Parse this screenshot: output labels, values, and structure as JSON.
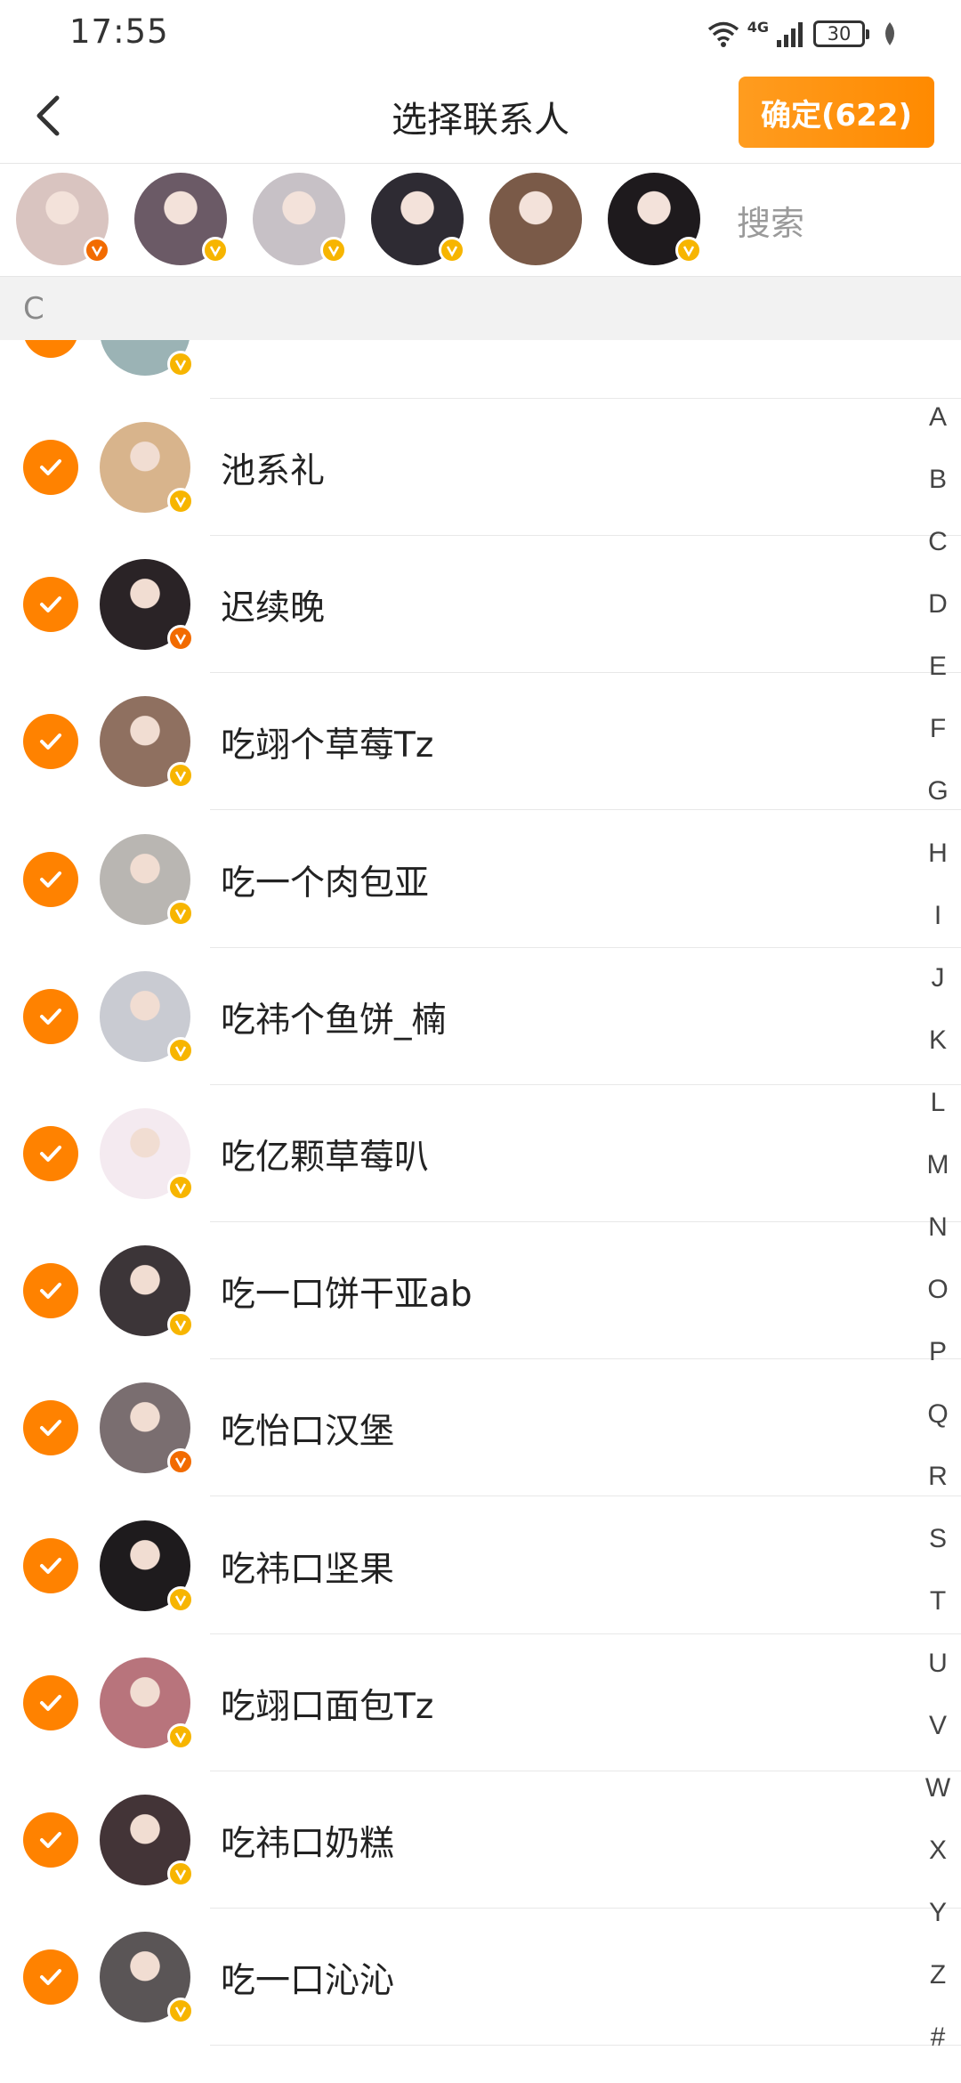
{
  "status_bar": {
    "time": "17:55",
    "battery": "30",
    "network": "4G"
  },
  "header": {
    "title": "选择联系人",
    "confirm_label": "确定(622)"
  },
  "selected_strip": {
    "search_placeholder": "搜索",
    "avatars": [
      {
        "badge": "orange",
        "color": "#d9c4c0"
      },
      {
        "badge": "gold",
        "color": "#6b5a66"
      },
      {
        "badge": "gold",
        "color": "#c7c1c6"
      },
      {
        "badge": "gold",
        "color": "#2e2b33"
      },
      {
        "badge": "none",
        "color": "#7a5a48"
      },
      {
        "badge": "gold",
        "color": "#1e1a1d"
      }
    ]
  },
  "section": {
    "letter": "C"
  },
  "contacts": [
    {
      "name": "池系礼",
      "badge": "gold",
      "color": "#d8b48c"
    },
    {
      "name": "迟续晚",
      "badge": "orange",
      "color": "#2a2326"
    },
    {
      "name": "吃翊个草莓Tz",
      "badge": "gold",
      "color": "#8f7060"
    },
    {
      "name": "吃一个肉包亚",
      "badge": "gold",
      "color": "#b9b6b2"
    },
    {
      "name": "吃祎个鱼饼_楠",
      "badge": "gold",
      "color": "#c9cbd2"
    },
    {
      "name": "吃亿颗草莓叭",
      "badge": "gold",
      "color": "#f4eaf0"
    },
    {
      "name": "吃一口饼干亚ab",
      "badge": "gold",
      "color": "#3c3538"
    },
    {
      "name": "吃怡口汉堡",
      "badge": "orange",
      "color": "#7a6e70"
    },
    {
      "name": "吃祎口坚果",
      "badge": "gold",
      "color": "#1e1b1d"
    },
    {
      "name": "吃翊口面包Tz",
      "badge": "gold",
      "color": "#b8747c"
    },
    {
      "name": "吃祎口奶糕",
      "badge": "gold",
      "color": "#433437"
    },
    {
      "name": "吃一口沁沁",
      "badge": "gold",
      "color": "#5a5556"
    }
  ],
  "index_letters": [
    "A",
    "B",
    "C",
    "D",
    "E",
    "F",
    "G",
    "H",
    "I",
    "J",
    "K",
    "L",
    "M",
    "N",
    "O",
    "P",
    "Q",
    "R",
    "S",
    "T",
    "U",
    "V",
    "W",
    "X",
    "Y",
    "Z",
    "#"
  ],
  "colors": {
    "accent": "#ff8200",
    "badge_gold": "#f7b500",
    "badge_orange": "#f26b00"
  }
}
